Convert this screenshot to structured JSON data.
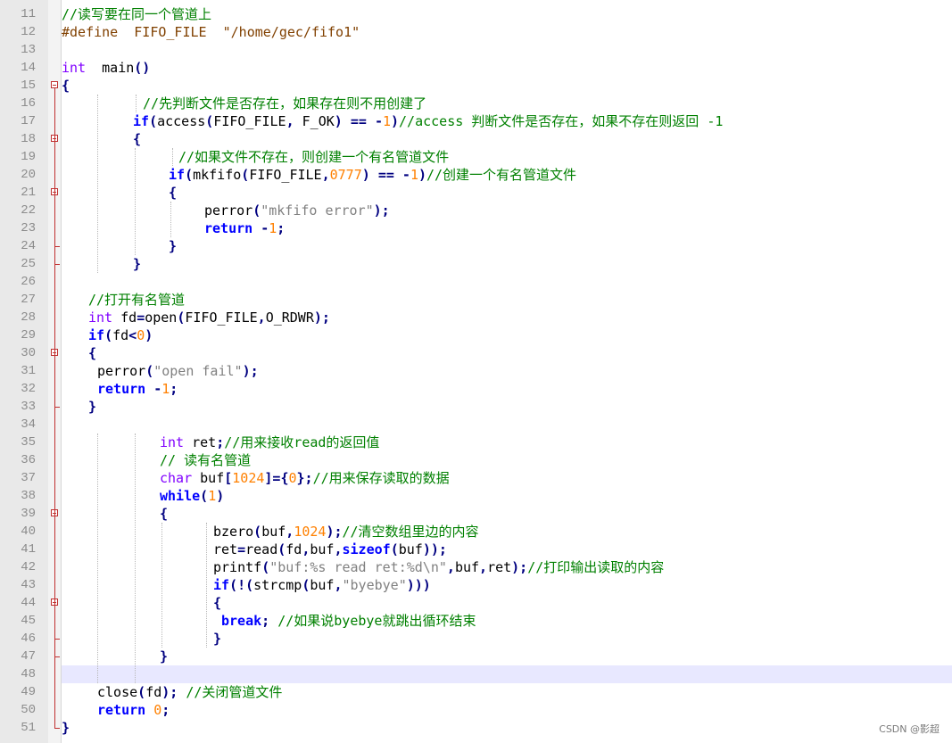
{
  "watermark": "CSDN @影超",
  "current_line": 48,
  "lines": [
    {
      "n": "11",
      "tokens": [
        [
          "c",
          "//读写要在同一个管道上"
        ]
      ]
    },
    {
      "n": "12",
      "tokens": [
        [
          "pp",
          "#define  FIFO_FILE  \"/home/gec/fifo1\""
        ]
      ]
    },
    {
      "n": "13",
      "tokens": []
    },
    {
      "n": "14",
      "tokens": [
        [
          "t",
          "int"
        ],
        [
          "",
          "  main"
        ],
        [
          "p",
          "()"
        ]
      ]
    },
    {
      "n": "15",
      "tokens": [
        [
          "p",
          "{"
        ]
      ]
    },
    {
      "n": "16",
      "tokens": [
        [
          "c",
          "//先判断文件是否存在，如果存在则不用创建了"
        ]
      ]
    },
    {
      "n": "17",
      "tokens": [
        [
          "k",
          "if"
        ],
        [
          "p",
          "("
        ],
        [
          "",
          "access"
        ],
        [
          "p",
          "("
        ],
        [
          "",
          "FIFO_FILE"
        ],
        [
          "p",
          ","
        ],
        [
          "",
          " F_OK"
        ],
        [
          "p",
          ")"
        ],
        [
          "",
          " "
        ],
        [
          "p",
          "=="
        ],
        [
          "",
          " "
        ],
        [
          "p",
          "-"
        ],
        [
          "n",
          "1"
        ],
        [
          "p",
          ")"
        ],
        [
          "c",
          "//access 判断文件是否存在，如果不存在则返回 -1"
        ]
      ]
    },
    {
      "n": "18",
      "tokens": [
        [
          "p",
          "{"
        ]
      ]
    },
    {
      "n": "19",
      "tokens": [
        [
          "c",
          "//如果文件不存在，则创建一个有名管道文件"
        ]
      ]
    },
    {
      "n": "20",
      "tokens": [
        [
          "k",
          "if"
        ],
        [
          "p",
          "("
        ],
        [
          "",
          "mkfifo"
        ],
        [
          "p",
          "("
        ],
        [
          "",
          "FIFO_FILE"
        ],
        [
          "p",
          ","
        ],
        [
          "n",
          "0777"
        ],
        [
          "p",
          ")"
        ],
        [
          "",
          " "
        ],
        [
          "p",
          "=="
        ],
        [
          "",
          " "
        ],
        [
          "p",
          "-"
        ],
        [
          "n",
          "1"
        ],
        [
          "p",
          ")"
        ],
        [
          "c",
          "//创建一个有名管道文件"
        ]
      ]
    },
    {
      "n": "21",
      "tokens": [
        [
          "p",
          "{"
        ]
      ]
    },
    {
      "n": "22",
      "tokens": [
        [
          "",
          "perror"
        ],
        [
          "p",
          "("
        ],
        [
          "s",
          "\"mkfifo error\""
        ],
        [
          "p",
          ");"
        ]
      ]
    },
    {
      "n": "23",
      "tokens": [
        [
          "k",
          "return"
        ],
        [
          "",
          " "
        ],
        [
          "p",
          "-"
        ],
        [
          "n",
          "1"
        ],
        [
          "p",
          ";"
        ]
      ]
    },
    {
      "n": "24",
      "tokens": [
        [
          "p",
          "}"
        ]
      ]
    },
    {
      "n": "25",
      "tokens": [
        [
          "p",
          "}"
        ]
      ]
    },
    {
      "n": "26",
      "tokens": []
    },
    {
      "n": "27",
      "tokens": [
        [
          "c",
          "//打开有名管道"
        ]
      ]
    },
    {
      "n": "28",
      "tokens": [
        [
          "t",
          "int"
        ],
        [
          "",
          " fd"
        ],
        [
          "p",
          "="
        ],
        [
          "",
          "open"
        ],
        [
          "p",
          "("
        ],
        [
          "",
          "FIFO_FILE"
        ],
        [
          "p",
          ","
        ],
        [
          "",
          "O_RDWR"
        ],
        [
          "p",
          ");"
        ]
      ]
    },
    {
      "n": "29",
      "tokens": [
        [
          "k",
          "if"
        ],
        [
          "p",
          "("
        ],
        [
          "",
          "fd"
        ],
        [
          "p",
          "<"
        ],
        [
          "n",
          "0"
        ],
        [
          "p",
          ")"
        ]
      ]
    },
    {
      "n": "30",
      "tokens": [
        [
          "p",
          "{"
        ]
      ]
    },
    {
      "n": "31",
      "tokens": [
        [
          "",
          "perror"
        ],
        [
          "p",
          "("
        ],
        [
          "s",
          "\"open fail\""
        ],
        [
          "p",
          ");"
        ]
      ]
    },
    {
      "n": "32",
      "tokens": [
        [
          "k",
          "return"
        ],
        [
          "",
          " "
        ],
        [
          "p",
          "-"
        ],
        [
          "n",
          "1"
        ],
        [
          "p",
          ";"
        ]
      ]
    },
    {
      "n": "33",
      "tokens": [
        [
          "p",
          "}"
        ]
      ]
    },
    {
      "n": "34",
      "tokens": []
    },
    {
      "n": "35",
      "tokens": [
        [
          "t",
          "int"
        ],
        [
          "",
          " ret"
        ],
        [
          "p",
          ";"
        ],
        [
          "c",
          "//用来接收read的返回值"
        ]
      ]
    },
    {
      "n": "36",
      "tokens": [
        [
          "c",
          "// 读有名管道"
        ]
      ]
    },
    {
      "n": "37",
      "tokens": [
        [
          "t",
          "char"
        ],
        [
          "",
          " buf"
        ],
        [
          "p",
          "["
        ],
        [
          "n",
          "1024"
        ],
        [
          "p",
          "]={"
        ],
        [
          "n",
          "0"
        ],
        [
          "p",
          "};"
        ],
        [
          "c",
          "//用来保存读取的数据"
        ]
      ]
    },
    {
      "n": "38",
      "tokens": [
        [
          "k",
          "while"
        ],
        [
          "p",
          "("
        ],
        [
          "n",
          "1"
        ],
        [
          "p",
          ")"
        ]
      ]
    },
    {
      "n": "39",
      "tokens": [
        [
          "p",
          "{"
        ]
      ]
    },
    {
      "n": "40",
      "tokens": [
        [
          "",
          "bzero"
        ],
        [
          "p",
          "("
        ],
        [
          "",
          "buf"
        ],
        [
          "p",
          ","
        ],
        [
          "n",
          "1024"
        ],
        [
          "p",
          ");"
        ],
        [
          "c",
          "//清空数组里边的内容"
        ]
      ]
    },
    {
      "n": "41",
      "tokens": [
        [
          "",
          "ret"
        ],
        [
          "p",
          "="
        ],
        [
          "",
          "read"
        ],
        [
          "p",
          "("
        ],
        [
          "",
          "fd"
        ],
        [
          "p",
          ","
        ],
        [
          "",
          "buf"
        ],
        [
          "p",
          ","
        ],
        [
          "k",
          "sizeof"
        ],
        [
          "p",
          "("
        ],
        [
          "",
          "buf"
        ],
        [
          "p",
          "));"
        ]
      ]
    },
    {
      "n": "42",
      "tokens": [
        [
          "",
          "printf"
        ],
        [
          "p",
          "("
        ],
        [
          "s",
          "\"buf:%s read ret:%d\\n\""
        ],
        [
          "p",
          ","
        ],
        [
          "",
          "buf"
        ],
        [
          "p",
          ","
        ],
        [
          "",
          "ret"
        ],
        [
          "p",
          ");"
        ],
        [
          "c",
          "//打印输出读取的内容"
        ]
      ]
    },
    {
      "n": "43",
      "tokens": [
        [
          "k",
          "if"
        ],
        [
          "p",
          "(!("
        ],
        [
          "",
          "strcmp"
        ],
        [
          "p",
          "("
        ],
        [
          "",
          "buf"
        ],
        [
          "p",
          ","
        ],
        [
          "s",
          "\"byebye\""
        ],
        [
          "p",
          ")))"
        ]
      ]
    },
    {
      "n": "44",
      "tokens": [
        [
          "p",
          "{"
        ]
      ]
    },
    {
      "n": "45",
      "tokens": [
        [
          "k",
          "break"
        ],
        [
          "p",
          ";"
        ],
        [
          "",
          " "
        ],
        [
          "c",
          "//如果说byebye就跳出循环结束"
        ]
      ]
    },
    {
      "n": "46",
      "tokens": [
        [
          "p",
          "}"
        ]
      ]
    },
    {
      "n": "47",
      "tokens": [
        [
          "p",
          "}"
        ]
      ]
    },
    {
      "n": "48",
      "tokens": []
    },
    {
      "n": "49",
      "tokens": [
        [
          "",
          "close"
        ],
        [
          "p",
          "("
        ],
        [
          "",
          "fd"
        ],
        [
          "p",
          ");"
        ],
        [
          "",
          " "
        ],
        [
          "c",
          "//关闭管道文件"
        ]
      ]
    },
    {
      "n": "50",
      "tokens": [
        [
          "k",
          "return"
        ],
        [
          "",
          " "
        ],
        [
          "n",
          "0"
        ],
        [
          "p",
          ";"
        ]
      ]
    },
    {
      "n": "51",
      "tokens": [
        [
          "p",
          "}"
        ]
      ]
    }
  ]
}
